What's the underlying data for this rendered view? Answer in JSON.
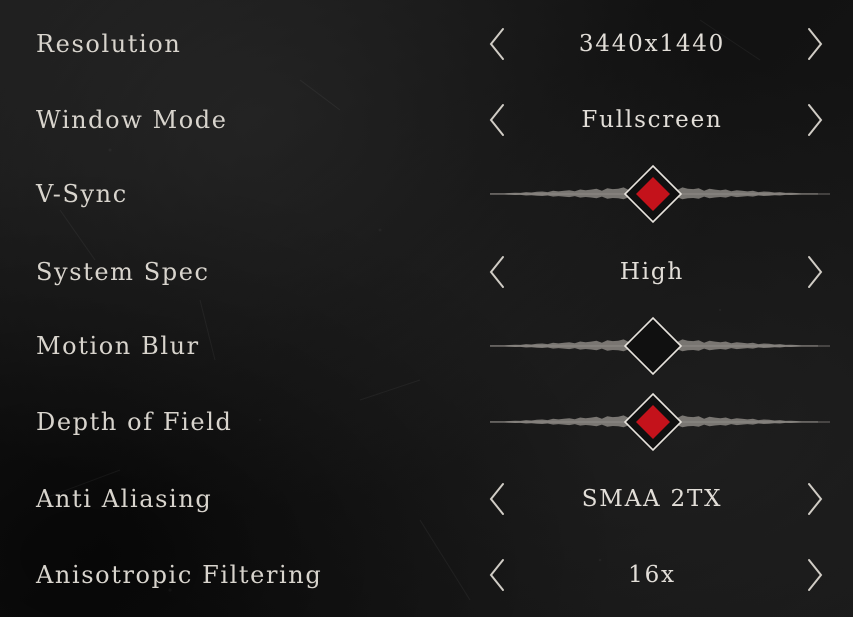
{
  "settings": [
    {
      "id": "resolution",
      "label": "Resolution",
      "type": "selector",
      "value": "3440x1440"
    },
    {
      "id": "window-mode",
      "label": "Window Mode",
      "type": "selector",
      "value": "Fullscreen"
    },
    {
      "id": "v-sync",
      "label": "V-Sync",
      "type": "toggle",
      "enabled": true
    },
    {
      "id": "system-spec",
      "label": "System Spec",
      "type": "selector",
      "value": "High"
    },
    {
      "id": "motion-blur",
      "label": "Motion Blur",
      "type": "toggle",
      "enabled": false
    },
    {
      "id": "depth-of-field",
      "label": "Depth of Field",
      "type": "toggle",
      "enabled": true
    },
    {
      "id": "anti-aliasing",
      "label": "Anti Aliasing",
      "type": "selector",
      "value": "SMAA 2TX"
    },
    {
      "id": "anisotropic-filtering",
      "label": "Anisotropic Filtering",
      "type": "selector",
      "value": "16x"
    }
  ],
  "icons": {
    "prev": "chevron-left-icon",
    "next": "chevron-right-icon",
    "toggle": "diamond-toggle-icon"
  },
  "colors": {
    "background": "#141414",
    "text": "#d8d4cd",
    "toggle_on": "#c4121b",
    "toggle_border": "#e8e4de",
    "waveform": "#9a9690"
  }
}
